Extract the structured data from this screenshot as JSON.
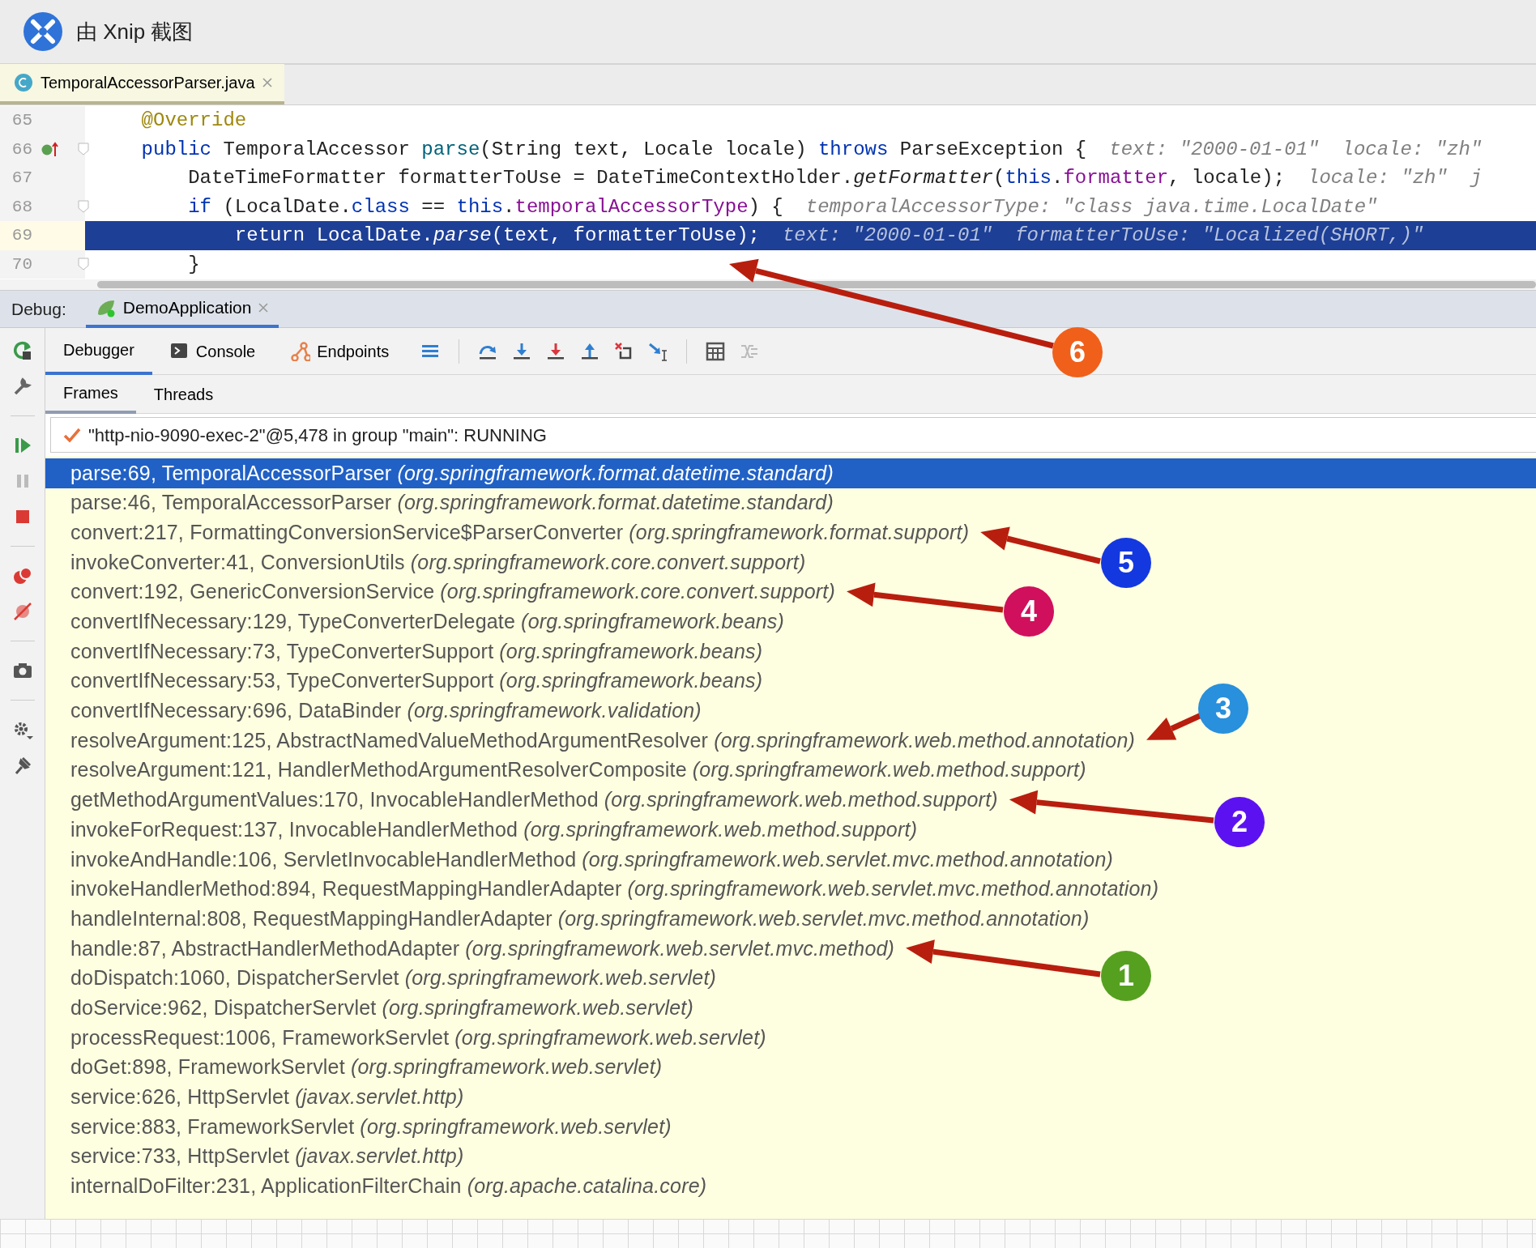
{
  "title_bar": {
    "title": "由 Xnip 截图"
  },
  "editor": {
    "tabs": [
      {
        "label": "TemporalAccessorParser.java",
        "selected": true
      }
    ],
    "lines": [
      {
        "number": "65",
        "current": false,
        "segments": [
          {
            "kind": "annotation",
            "text": "    @Override"
          }
        ]
      },
      {
        "number": "66",
        "current": false,
        "segments": [
          {
            "kind": "keyword",
            "text": "    public"
          },
          {
            "kind": "plain",
            "text": " TemporalAccessor "
          },
          {
            "kind": "method",
            "text": "parse"
          },
          {
            "kind": "plain",
            "text": "(String text, Locale locale) "
          },
          {
            "kind": "keyword",
            "text": "throws"
          },
          {
            "kind": "plain",
            "text": " ParseException {"
          },
          {
            "kind": "hint",
            "text": "text: \"2000-01-01\""
          },
          {
            "kind": "hint",
            "text": "locale: \"zh\""
          }
        ]
      },
      {
        "number": "67",
        "current": false,
        "segments": [
          {
            "kind": "plain",
            "text": "        DateTimeFormatter formatterToUse = DateTimeContextHolder."
          },
          {
            "kind": "call",
            "text": "getFormatter"
          },
          {
            "kind": "plain",
            "text": "("
          },
          {
            "kind": "keyword",
            "text": "this"
          },
          {
            "kind": "plain",
            "text": "."
          },
          {
            "kind": "field",
            "text": "formatter"
          },
          {
            "kind": "plain",
            "text": ", locale);"
          },
          {
            "kind": "hint",
            "text": "locale: \"zh\""
          },
          {
            "kind": "hint",
            "text": "j"
          }
        ]
      },
      {
        "number": "68",
        "current": false,
        "segments": [
          {
            "kind": "keyword",
            "text": "        if"
          },
          {
            "kind": "plain",
            "text": " (LocalDate."
          },
          {
            "kind": "keyword",
            "text": "class"
          },
          {
            "kind": "plain",
            "text": " == "
          },
          {
            "kind": "keyword",
            "text": "this"
          },
          {
            "kind": "plain",
            "text": "."
          },
          {
            "kind": "field",
            "text": "temporalAccessorType"
          },
          {
            "kind": "plain",
            "text": ") {"
          },
          {
            "kind": "hint",
            "text": "temporalAccessorType: \"class java.time.LocalDate\""
          }
        ]
      },
      {
        "number": "69",
        "current": true,
        "segments": [
          {
            "kind": "plain",
            "text": "            return LocalDate."
          },
          {
            "kind": "call",
            "text": "parse"
          },
          {
            "kind": "plain",
            "text": "(text, formatterToUse);"
          },
          {
            "kind": "hint",
            "text": "text: \"2000-01-01\""
          },
          {
            "kind": "hint",
            "text": "formatterToUse: \"Localized(SHORT,)\""
          }
        ]
      },
      {
        "number": "70",
        "current": false,
        "segments": [
          {
            "kind": "plain",
            "text": "        }"
          }
        ]
      }
    ]
  },
  "debug": {
    "label": "Debug:",
    "sessions": [
      {
        "label": "DemoApplication",
        "selected": true
      }
    ],
    "tabs": [
      {
        "label": "Debugger",
        "kind": "debugger",
        "selected": true
      },
      {
        "label": "Console",
        "kind": "console",
        "selected": false
      },
      {
        "label": "Endpoints",
        "kind": "endpoints",
        "selected": false
      }
    ],
    "subtabs": [
      {
        "label": "Frames",
        "selected": true
      },
      {
        "label": "Threads",
        "selected": false
      }
    ],
    "thread": "\"http-nio-9090-exec-2\"@5,478 in group \"main\": RUNNING",
    "frames": [
      {
        "method": "parse:69, TemporalAccessorParser",
        "package": "(org.springframework.format.datetime.standard)",
        "selected": true
      },
      {
        "method": "parse:46, TemporalAccessorParser",
        "package": "(org.springframework.format.datetime.standard)",
        "selected": false
      },
      {
        "method": "convert:217, FormattingConversionService$ParserConverter",
        "package": "(org.springframework.format.support)",
        "selected": false
      },
      {
        "method": "invokeConverter:41, ConversionUtils",
        "package": "(org.springframework.core.convert.support)",
        "selected": false
      },
      {
        "method": "convert:192, GenericConversionService",
        "package": "(org.springframework.core.convert.support)",
        "selected": false
      },
      {
        "method": "convertIfNecessary:129, TypeConverterDelegate",
        "package": "(org.springframework.beans)",
        "selected": false
      },
      {
        "method": "convertIfNecessary:73, TypeConverterSupport",
        "package": "(org.springframework.beans)",
        "selected": false
      },
      {
        "method": "convertIfNecessary:53, TypeConverterSupport",
        "package": "(org.springframework.beans)",
        "selected": false
      },
      {
        "method": "convertIfNecessary:696, DataBinder",
        "package": "(org.springframework.validation)",
        "selected": false
      },
      {
        "method": "resolveArgument:125, AbstractNamedValueMethodArgumentResolver",
        "package": "(org.springframework.web.method.annotation)",
        "selected": false
      },
      {
        "method": "resolveArgument:121, HandlerMethodArgumentResolverComposite",
        "package": "(org.springframework.web.method.support)",
        "selected": false
      },
      {
        "method": "getMethodArgumentValues:170, InvocableHandlerMethod",
        "package": "(org.springframework.web.method.support)",
        "selected": false
      },
      {
        "method": "invokeForRequest:137, InvocableHandlerMethod",
        "package": "(org.springframework.web.method.support)",
        "selected": false
      },
      {
        "method": "invokeAndHandle:106, ServletInvocableHandlerMethod",
        "package": "(org.springframework.web.servlet.mvc.method.annotation)",
        "selected": false
      },
      {
        "method": "invokeHandlerMethod:894, RequestMappingHandlerAdapter",
        "package": "(org.springframework.web.servlet.mvc.method.annotation)",
        "selected": false
      },
      {
        "method": "handleInternal:808, RequestMappingHandlerAdapter",
        "package": "(org.springframework.web.servlet.mvc.method.annotation)",
        "selected": false
      },
      {
        "method": "handle:87, AbstractHandlerMethodAdapter",
        "package": "(org.springframework.web.servlet.mvc.method)",
        "selected": false
      },
      {
        "method": "doDispatch:1060, DispatcherServlet",
        "package": "(org.springframework.web.servlet)",
        "selected": false
      },
      {
        "method": "doService:962, DispatcherServlet",
        "package": "(org.springframework.web.servlet)",
        "selected": false
      },
      {
        "method": "processRequest:1006, FrameworkServlet",
        "package": "(org.springframework.web.servlet)",
        "selected": false
      },
      {
        "method": "doGet:898, FrameworkServlet",
        "package": "(org.springframework.web.servlet)",
        "selected": false
      },
      {
        "method": "service:626, HttpServlet",
        "package": "(javax.servlet.http)",
        "selected": false
      },
      {
        "method": "service:883, FrameworkServlet",
        "package": "(org.springframework.web.servlet)",
        "selected": false
      },
      {
        "method": "service:733, HttpServlet",
        "package": "(javax.servlet.http)",
        "selected": false
      },
      {
        "method": "internalDoFilter:231, ApplicationFilterChain",
        "package": "(org.apache.catalina.core)",
        "selected": false
      }
    ]
  },
  "annotations": [
    {
      "label": "6",
      "color": "#f0601a"
    },
    {
      "label": "5",
      "color": "#1438e0"
    },
    {
      "label": "4",
      "color": "#d0105c"
    },
    {
      "label": "3",
      "color": "#2890dc"
    },
    {
      "label": "2",
      "color": "#5c12f0"
    },
    {
      "label": "1",
      "color": "#56a020"
    }
  ]
}
